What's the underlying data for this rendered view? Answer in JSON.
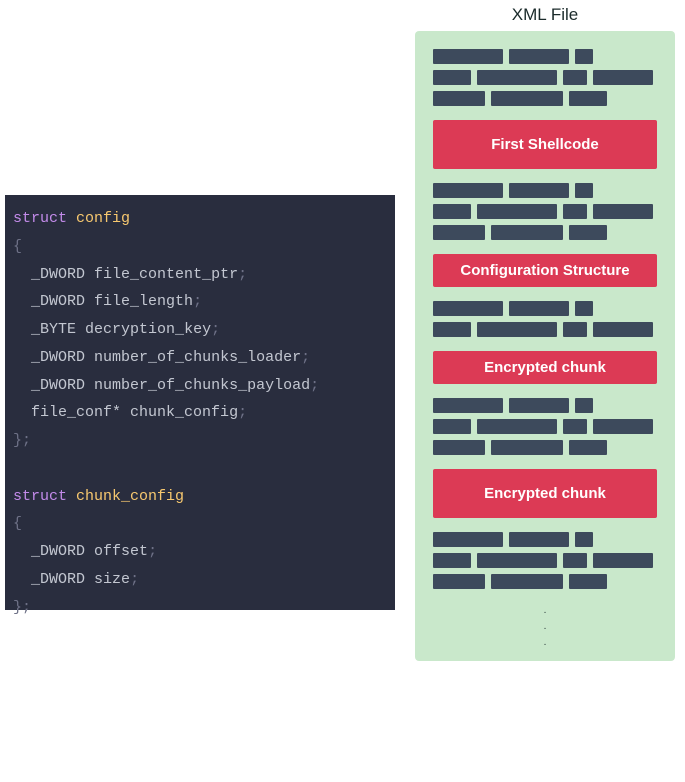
{
  "code": {
    "struct1_keyword": "struct",
    "struct1_name": "config",
    "brace_open": "{",
    "s1_f1_type": "_DWORD",
    "s1_f1_name": "file_content_ptr",
    "s1_f2_type": "_DWORD",
    "s1_f2_name": "file_length",
    "s1_f3_type": "_BYTE",
    "s1_f3_name": "decryption_key",
    "s1_f4_type": "_DWORD",
    "s1_f4_name": "number_of_chunks_loader",
    "s1_f5_type": "_DWORD",
    "s1_f5_name": "number_of_chunks_payload",
    "s1_f6_type": "file_conf*",
    "s1_f6_name": "chunk_config",
    "brace_close_semi": "};",
    "struct2_keyword": "struct",
    "struct2_name": "chunk_config",
    "s2_f1_type": "_DWORD",
    "s2_f1_name": "offset",
    "s2_f2_type": "_DWORD",
    "s2_f2_name": "size",
    "semi": ";"
  },
  "xml": {
    "title": "XML File",
    "labels": [
      "First Shellcode",
      "Configuration Structure",
      "Encrypted chunk",
      "Encrypted chunk"
    ],
    "ellipsis": ".\n.\n."
  }
}
